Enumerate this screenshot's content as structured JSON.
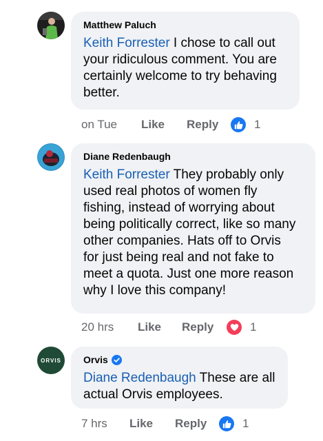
{
  "comments": [
    {
      "author": "Matthew Paluch",
      "mention": "Keith Forrester",
      "text_lines": [
        " I chose to call out",
        "your ridiculous comment.  You are",
        "certainly welcome to try behaving",
        "better."
      ],
      "time": "on Tue",
      "like_label": "Like",
      "reply_label": "Reply",
      "reaction_icon": "like-reaction-icon",
      "reaction_count": "1"
    },
    {
      "author": "Diane Redenbaugh",
      "mention": "Keith Forrester",
      "text_lines": [
        " They probably only",
        "used real photos of women fly",
        "fishing, instead of worrying about",
        "being politically correct, like so many",
        "other companies.  Hats off to Orvis",
        "for just being real and not fake to",
        "meet a quota.  Just one more reason",
        "why I love this company!"
      ],
      "time": "20 hrs",
      "like_label": "Like",
      "reply_label": "Reply",
      "reaction_icon": "love-reaction-icon",
      "reaction_count": "1"
    },
    {
      "author": "Orvis",
      "verified_icon": "verified-badge-icon",
      "avatar_text": "ORVIS",
      "mention": "Diane Redenbaugh",
      "text_lines": [
        " These are all",
        "actual Orvis employees."
      ],
      "time": "7 hrs",
      "like_label": "Like",
      "reply_label": "Reply",
      "reaction_icon": "like-reaction-icon",
      "reaction_count": "1"
    }
  ],
  "colors": {
    "mention": "#1a5fb4",
    "bubble": "#f0f2f5",
    "meta": "#65676b",
    "like_reaction": "#1877f2",
    "love_reaction": "#f33e58",
    "orvis_green": "#1f4a35",
    "verified": "#1877f2"
  }
}
